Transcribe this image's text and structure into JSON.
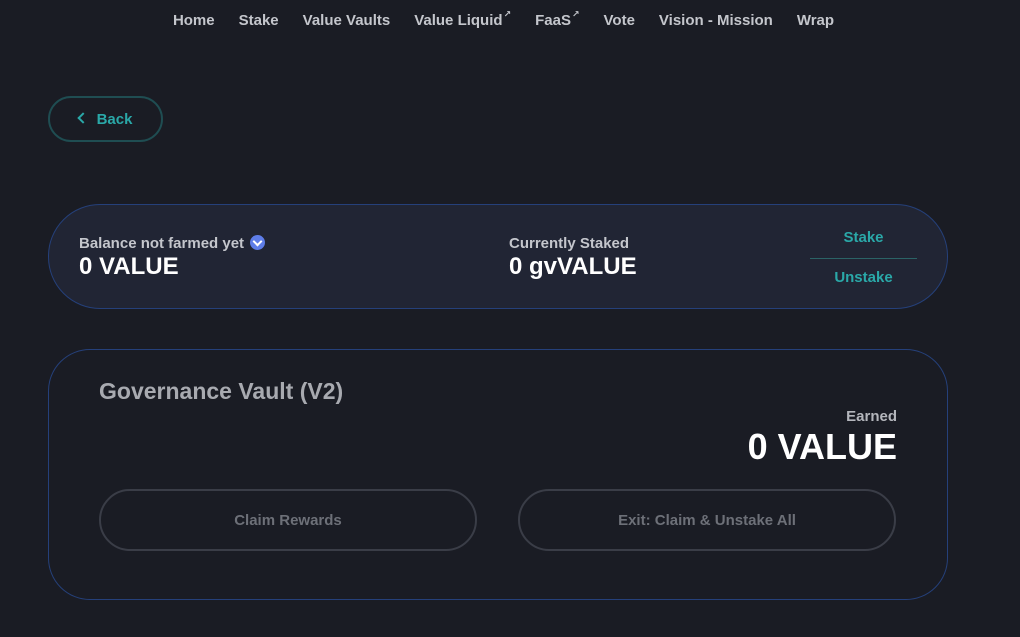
{
  "nav": {
    "items": [
      {
        "label": "Home",
        "external": false
      },
      {
        "label": "Stake",
        "external": false
      },
      {
        "label": "Value Vaults",
        "external": false
      },
      {
        "label": "Value Liquid",
        "external": true
      },
      {
        "label": "FaaS",
        "external": true
      },
      {
        "label": "Vote",
        "external": false
      },
      {
        "label": "Vision - Mission",
        "external": false
      },
      {
        "label": "Wrap",
        "external": false
      }
    ],
    "external_glyph": "↗"
  },
  "back": {
    "label": "Back"
  },
  "balance": {
    "not_farmed_label": "Balance not farmed yet",
    "not_farmed_value": "0 VALUE",
    "staked_label": "Currently Staked",
    "staked_value": "0 gvVALUE",
    "stake_label": "Stake",
    "unstake_label": "Unstake"
  },
  "vault": {
    "title": "Governance Vault (V2)",
    "earned_label": "Earned",
    "earned_value": "0 VALUE",
    "claim_label": "Claim Rewards",
    "exit_label": "Exit: Claim & Unstake All"
  },
  "colors": {
    "background": "#1a1c24",
    "accent_teal": "#2aa8a8",
    "card_border": "#25407a",
    "chevron_badge": "#5e7de8"
  }
}
